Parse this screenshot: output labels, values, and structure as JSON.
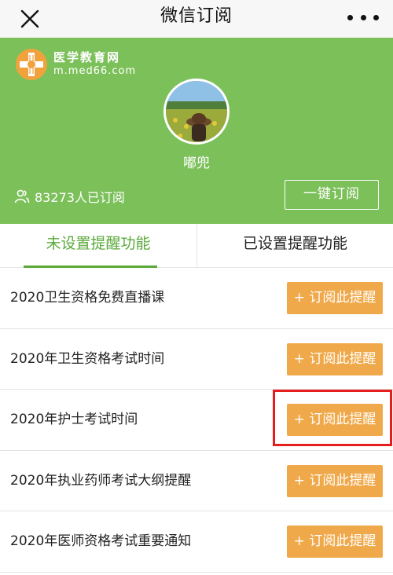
{
  "navbar": {
    "title": "微信订阅",
    "close_icon": "close-icon",
    "more_icon": "more-dots-icon"
  },
  "header": {
    "logo_name": "医学教育网",
    "logo_url": "m.med66.com",
    "username": "嘟兜",
    "subscriber_count": "83273人已订阅",
    "one_key_button": "一键订阅",
    "colors": {
      "header_bg": "#7cc05a",
      "accent_orange": "#f0a94a",
      "accent_green": "#5aa93a"
    }
  },
  "tabs": [
    {
      "label": "未设置提醒功能",
      "active": true
    },
    {
      "label": "已设置提醒功能",
      "active": false
    }
  ],
  "items": [
    {
      "title": "2020卫生资格免费直播课",
      "button": "+ 订阅此提醒"
    },
    {
      "title": "2020年卫生资格考试时间",
      "button": "+ 订阅此提醒"
    },
    {
      "title": "2020年护士考试时间",
      "button": "+ 订阅此提醒",
      "highlighted": true
    },
    {
      "title": "2020年执业药师考试大纲提醒",
      "button": "+ 订阅此提醒"
    },
    {
      "title": "2020年医师资格考试重要通知",
      "button": "+ 订阅此提醒"
    }
  ],
  "highlight_color": "#e61e1e"
}
